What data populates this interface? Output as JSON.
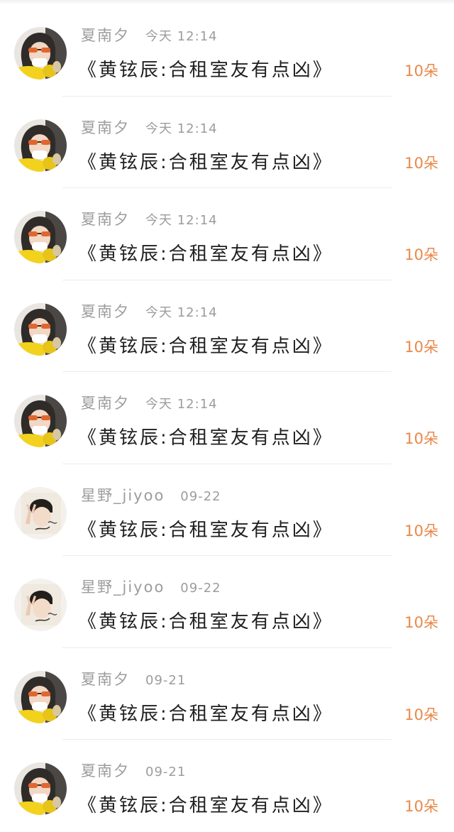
{
  "comments": [
    {
      "user": "夏南夕",
      "time": "今天 12:14",
      "title": "《黄铉辰:合租室友有点凶》",
      "gift": "10朵",
      "avatar": "girl-sunglasses-avatar-icon"
    },
    {
      "user": "夏南夕",
      "time": "今天 12:14",
      "title": "《黄铉辰:合租室友有点凶》",
      "gift": "10朵",
      "avatar": "girl-sunglasses-avatar-icon"
    },
    {
      "user": "夏南夕",
      "time": "今天 12:14",
      "title": "《黄铉辰:合租室友有点凶》",
      "gift": "10朵",
      "avatar": "girl-sunglasses-avatar-icon"
    },
    {
      "user": "夏南夕",
      "time": "今天 12:14",
      "title": "《黄铉辰:合租室友有点凶》",
      "gift": "10朵",
      "avatar": "girl-sunglasses-avatar-icon"
    },
    {
      "user": "夏南夕",
      "time": "今天 12:14",
      "title": "《黄铉辰:合租室友有点凶》",
      "gift": "10朵",
      "avatar": "girl-sunglasses-avatar-icon"
    },
    {
      "user": "星野_jiyoo",
      "time": "09-22",
      "title": "《黄铉辰:合租室友有点凶》",
      "gift": "10朵",
      "avatar": "boy-peace-sign-avatar-icon"
    },
    {
      "user": "星野_jiyoo",
      "time": "09-22",
      "title": "《黄铉辰:合租室友有点凶》",
      "gift": "10朵",
      "avatar": "boy-peace-sign-avatar-icon"
    },
    {
      "user": "夏南夕",
      "time": "09-21",
      "title": "《黄铉辰:合租室友有点凶》",
      "gift": "10朵",
      "avatar": "girl-sunglasses-avatar-icon"
    },
    {
      "user": "夏南夕",
      "time": "09-21",
      "title": "《黄铉辰:合租室友有点凶》",
      "gift": "10朵",
      "avatar": "girl-sunglasses-avatar-icon"
    }
  ],
  "colors": {
    "gift_orange": "#e8884a",
    "meta_gray": "#9c9c9c",
    "title_black": "#1f1f1f",
    "divider": "#ececec"
  }
}
